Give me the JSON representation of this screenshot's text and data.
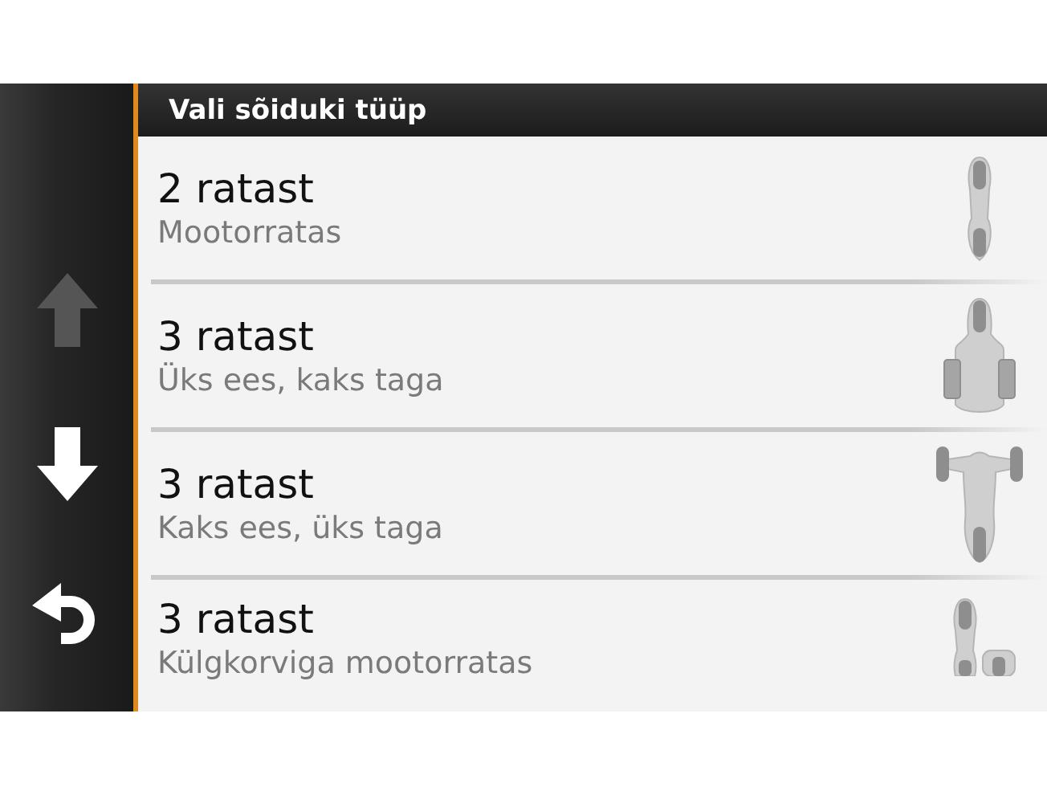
{
  "nav_buttons": [
    {
      "kind": "up",
      "disabled": true
    },
    {
      "kind": "down",
      "disabled": false
    },
    {
      "kind": "back",
      "disabled": false
    }
  ],
  "title": "Vali sõiduki tüüp",
  "options": [
    {
      "title": "2 ratast",
      "subtitle": "Mootorratas",
      "kind": "motorcycle"
    },
    {
      "title": "3 ratast",
      "subtitle": "Üks ees, kaks taga",
      "kind": "trike-rear"
    },
    {
      "title": "3 ratast",
      "subtitle": "Kaks ees, üks taga",
      "kind": "trike-front"
    },
    {
      "title": "3 ratast",
      "subtitle": "Külgkorviga mootorratas",
      "kind": "sidecar"
    }
  ]
}
